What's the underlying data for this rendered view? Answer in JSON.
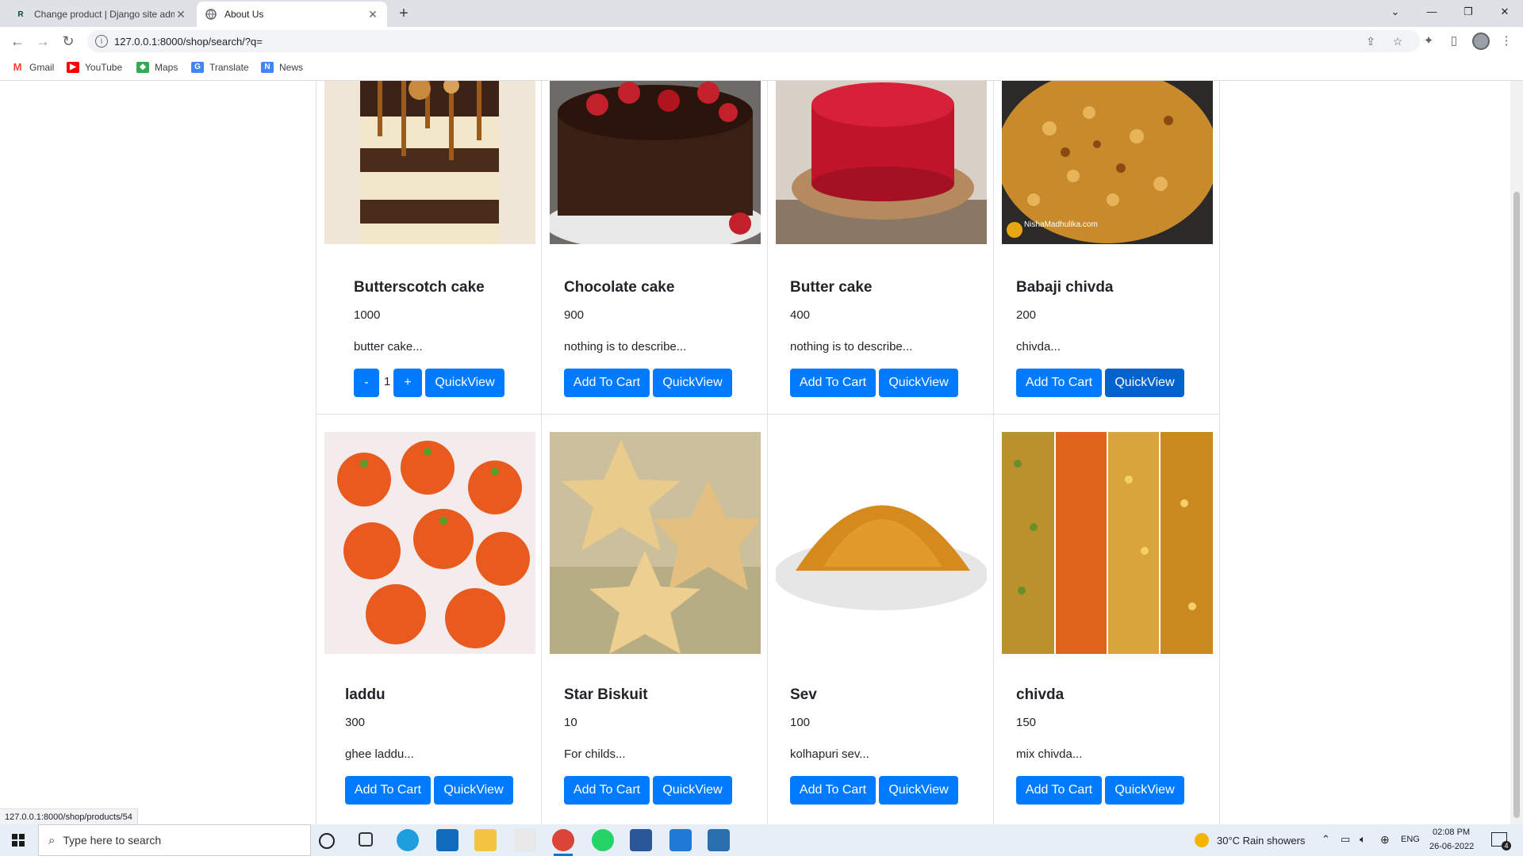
{
  "browser": {
    "tabs": [
      {
        "title": "Change product | Django site adm",
        "favicon": "django-icon"
      },
      {
        "title": "About Us",
        "favicon": "globe-icon"
      }
    ],
    "url": "127.0.0.1:8000/shop/search/?q=",
    "bookmarks": [
      "Gmail",
      "YouTube",
      "Maps",
      "Translate",
      "News"
    ]
  },
  "products": [
    {
      "name": "Butterscotch cake",
      "price": "1000",
      "desc": "butter cake...",
      "qty": "1",
      "minus": "-",
      "plus": "+",
      "quickview": "QuickView",
      "image": "butterscotch-cake-image"
    },
    {
      "name": "Chocolate cake",
      "price": "900",
      "desc": "nothing is to describe...",
      "add": "Add To Cart",
      "quickview": "QuickView",
      "image": "chocolate-cake-image"
    },
    {
      "name": "Butter cake",
      "price": "400",
      "desc": "nothing is to describe...",
      "add": "Add To Cart",
      "quickview": "QuickView",
      "image": "butter-cake-image"
    },
    {
      "name": "Babaji chivda",
      "price": "200",
      "desc": "chivda...",
      "add": "Add To Cart",
      "quickview": "QuickView",
      "image": "chivda-image",
      "watermark": "NishaMadhulika.com"
    },
    {
      "name": "laddu",
      "price": "300",
      "desc": "ghee laddu...",
      "add": "Add To Cart",
      "quickview": "QuickView",
      "image": "laddu-image"
    },
    {
      "name": "Star Biskuit",
      "price": "10",
      "desc": "For childs...",
      "add": "Add To Cart",
      "quickview": "QuickView",
      "image": "star-biscuit-image"
    },
    {
      "name": "Sev",
      "price": "100",
      "desc": "kolhapuri sev...",
      "add": "Add To Cart",
      "quickview": "QuickView",
      "image": "sev-image"
    },
    {
      "name": "chivda",
      "price": "150",
      "desc": "mix chivda...",
      "add": "Add To Cart",
      "quickview": "QuickView",
      "image": "mix-chivda-image"
    }
  ],
  "status_url": "127.0.0.1:8000/shop/products/54",
  "taskbar": {
    "search_placeholder": "Type here to search",
    "weather": "30°C  Rain showers",
    "lang": "ENG",
    "time": "02:08 PM",
    "date": "26-06-2022",
    "notifications": "4"
  },
  "colors": {
    "primary": "#007bff",
    "border": "#dee2e6"
  }
}
